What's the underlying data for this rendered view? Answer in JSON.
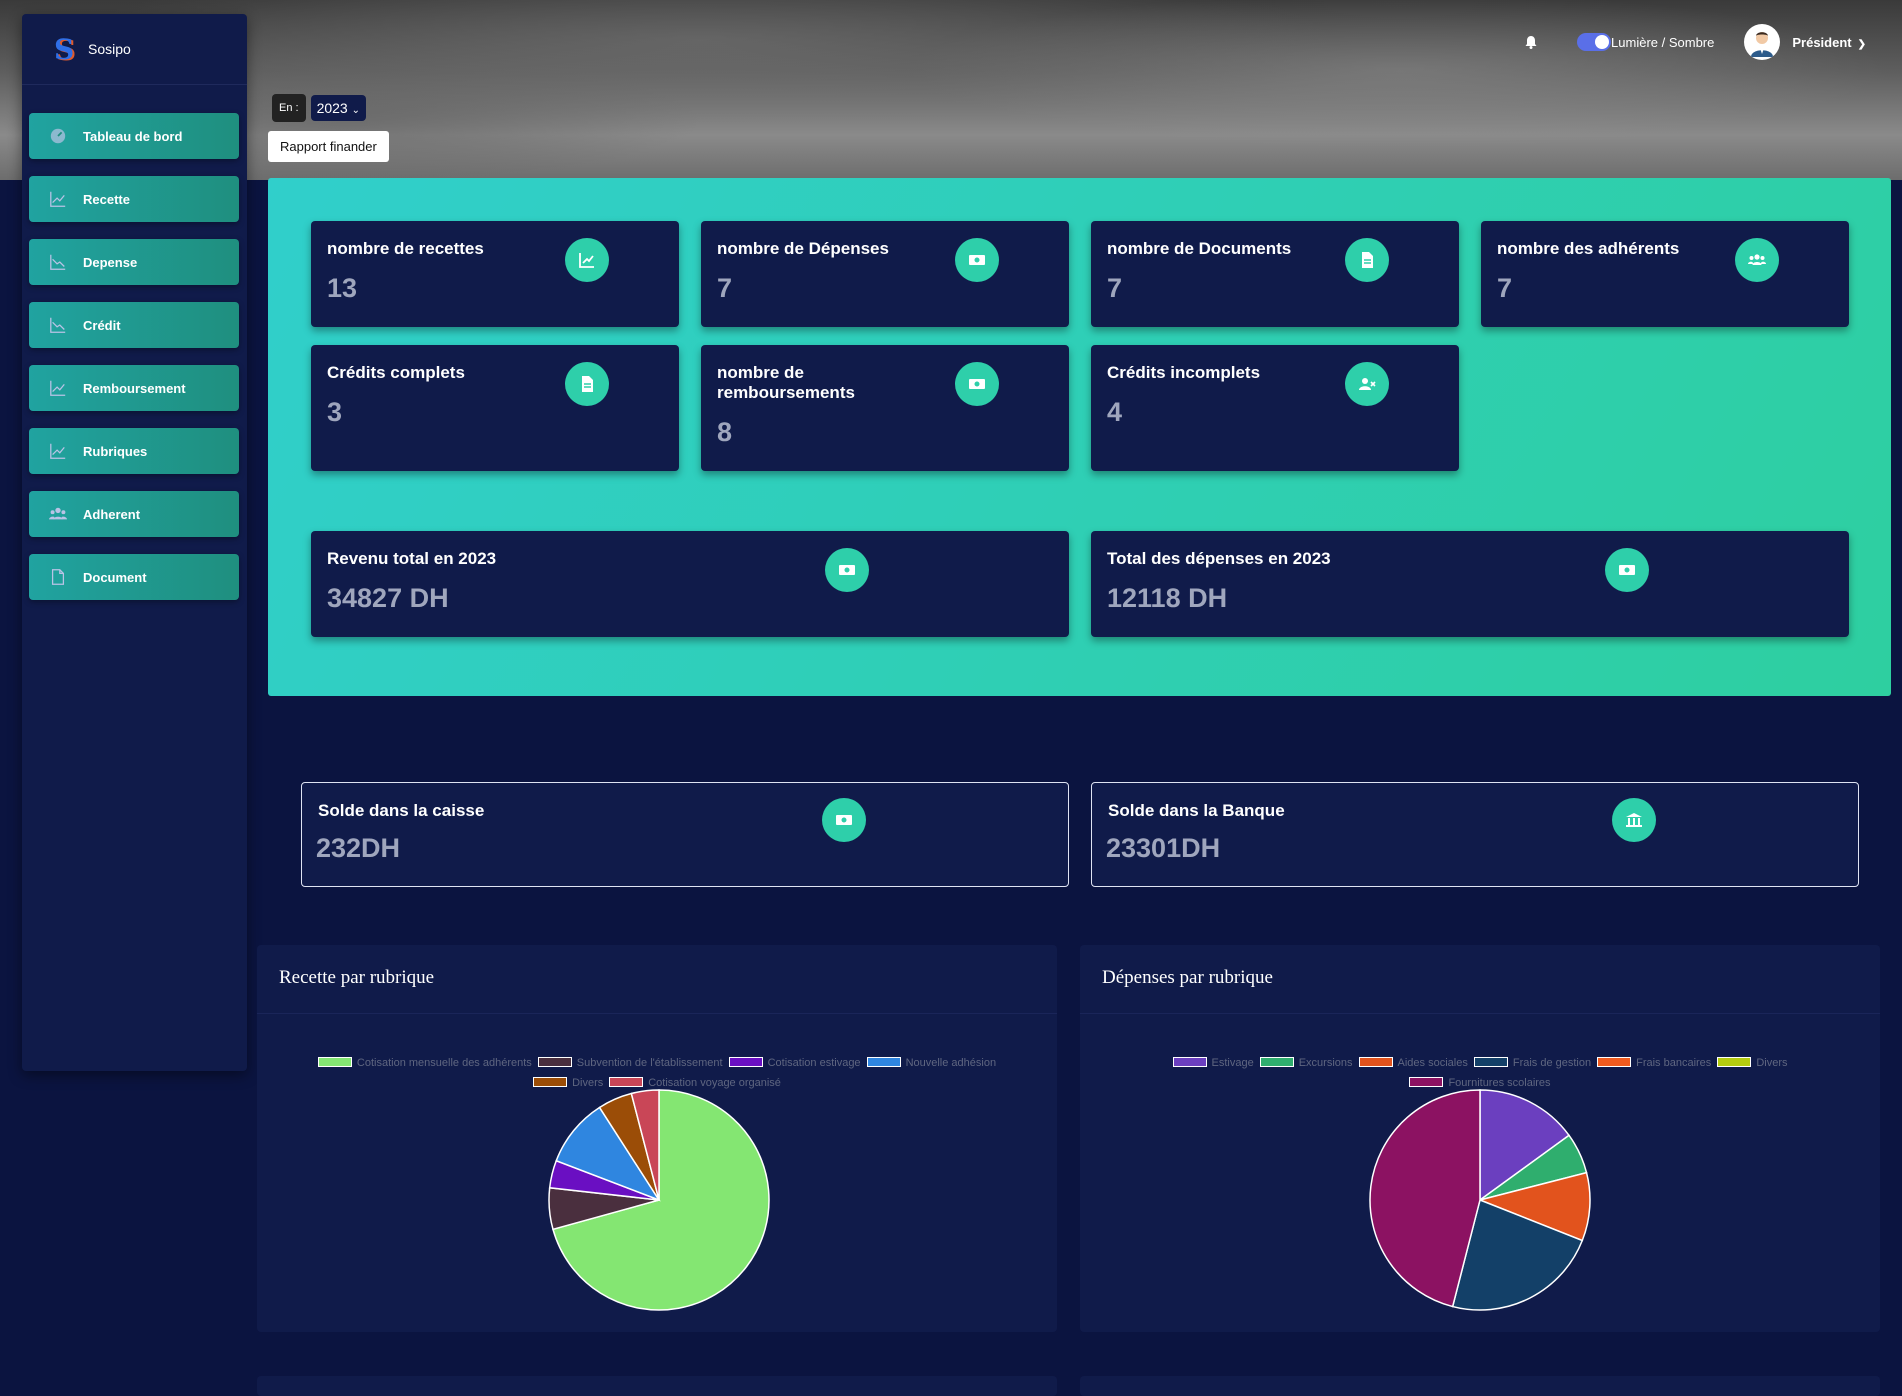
{
  "brand": {
    "name": "Sosipo",
    "logo_letter": "S"
  },
  "sidebar": {
    "items": [
      {
        "label": "Tableau de bord",
        "icon": "dashboard-icon"
      },
      {
        "label": "Recette",
        "icon": "chart-line-up-icon"
      },
      {
        "label": "Depense",
        "icon": "chart-line-down-icon"
      },
      {
        "label": "Crédit",
        "icon": "chart-line-down-icon"
      },
      {
        "label": "Remboursement",
        "icon": "chart-line-up-icon"
      },
      {
        "label": "Rubriques",
        "icon": "chart-line-up-icon"
      },
      {
        "label": "Adherent",
        "icon": "users-icon"
      },
      {
        "label": "Document",
        "icon": "file-icon"
      }
    ]
  },
  "topbar": {
    "theme_label": "Lumière / Sombre",
    "user": "Président"
  },
  "filter": {
    "en_label": "En :",
    "year": "2023",
    "report_button": "Rapport finander"
  },
  "stats": {
    "recettes": {
      "title": "nombre de recettes",
      "value": "13"
    },
    "depenses": {
      "title": "nombre de Dépenses",
      "value": "7"
    },
    "documents": {
      "title": "nombre de Documents",
      "value": "7"
    },
    "adherents": {
      "title": "nombre des adhérents",
      "value": "7"
    },
    "credits_complets": {
      "title": "Crédits complets",
      "value": "3"
    },
    "remboursements": {
      "title": "nombre de remboursements",
      "value": "8"
    },
    "credits_incomplets": {
      "title": "Crédits incomplets",
      "value": "4"
    },
    "revenu_total": {
      "title": "Revenu total en 2023",
      "value": "34827 DH"
    },
    "total_depenses": {
      "title": "Total des dépenses en 2023",
      "value": "12118 DH"
    }
  },
  "solde": {
    "caisse": {
      "title": "Solde dans la caisse",
      "value": "232DH"
    },
    "banque": {
      "title": "Solde dans la Banque",
      "value": "23301DH"
    }
  },
  "colors": {
    "accent": "#2ecfaa",
    "card_bg": "#101b4a",
    "page_bg": "#0b1440"
  },
  "chart_data": [
    {
      "type": "pie",
      "title": "Recette par rubrique",
      "categories": [
        "Cotisation mensuelle des adhérents",
        "Subvention de l'établissement",
        "Cotisation estivage",
        "Nouvelle adhésion",
        "Divers",
        "Cotisation voyage organisé"
      ],
      "values": [
        70,
        6,
        4,
        10,
        5,
        4
      ],
      "colors": [
        "#84e672",
        "#4a2f3e",
        "#6a0fc2",
        "#2f86e0",
        "#9b4d07",
        "#c94657"
      ]
    },
    {
      "type": "pie",
      "title": "Dépenses par rubrique",
      "categories": [
        "Estivage",
        "Excursions",
        "Aides sociales",
        "Frais de gestion",
        "Frais bancaires",
        "Divers",
        "Fournitures scolaires"
      ],
      "values": [
        15,
        6,
        10,
        23,
        0,
        0,
        46
      ],
      "colors": [
        "#6b3fbf",
        "#2fae6e",
        "#e2531d",
        "#134068",
        "#f05b20",
        "#b4cc10",
        "#8c1262"
      ]
    }
  ]
}
